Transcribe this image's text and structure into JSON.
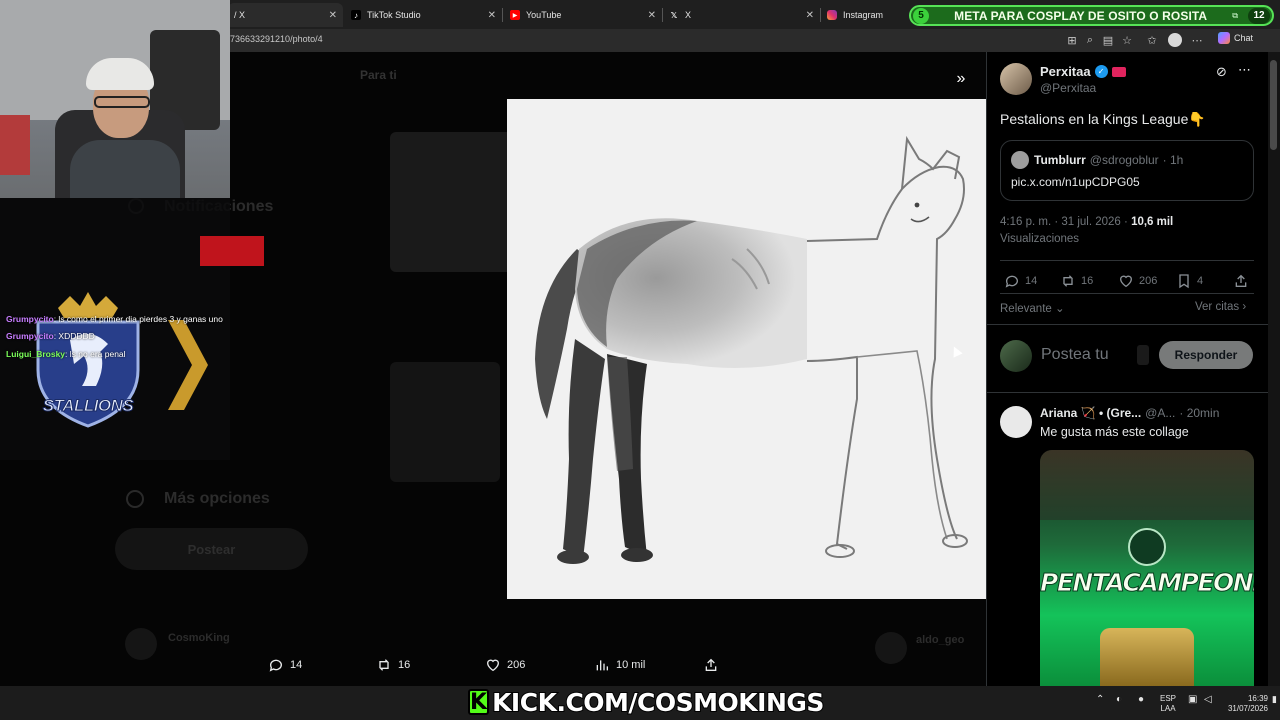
{
  "browser": {
    "tabs": [
      {
        "label": "/ X",
        "icon": "x-icon"
      },
      {
        "label": "TikTok Studio",
        "icon": "tiktok-icon"
      },
      {
        "label": "YouTube",
        "icon": "youtube-icon"
      },
      {
        "label": "X",
        "icon": "x-icon"
      },
      {
        "label": "Instagram",
        "icon": "instagram-icon"
      }
    ],
    "url": "736633291210/photo/4",
    "chat_label": "Chat"
  },
  "meta_goal": {
    "left_number": "5",
    "text": "META PARA COSPLAY DE OSITO O ROSITA",
    "count": "12"
  },
  "stream_chat": {
    "messages": [
      {
        "user": "Grumpycito",
        "text": ": ls como el primer dia pierdes 3 y ganas uno",
        "color": "#c77dff"
      },
      {
        "user": "Grumpycito",
        "text": ": XDDDDD",
        "color": "#c77dff"
      },
      {
        "user": "Luigui_Brosky",
        "text": ": ls no era penal",
        "color": "#7cff5a"
      }
    ],
    "team_logo_text": "STALLIONS"
  },
  "background_page": {
    "nav_notifications": "Notificaciones",
    "nav_more": "Más opciones",
    "post_button": "Postear",
    "for_you_tab": "Para ti",
    "side_user_1": "CosmoKing",
    "side_user_2": "aldo_geo"
  },
  "media_bar": {
    "replies": "14",
    "reposts": "16",
    "likes": "206",
    "views": "10 mil"
  },
  "tweet": {
    "author_name": "Perxitaa",
    "author_handle": "@Perxitaa",
    "text": "Pestalions en la Kings League👇",
    "quote": {
      "author_name": "Tumblurr",
      "author_handle": "@sdrogoblur",
      "time": "· 1h",
      "link": "pic.x.com/n1upCDPG05"
    },
    "timestamp": "4:16 p. m. · 31 jul. 2026 ·",
    "views_count": "10,6 mil",
    "views_label": "Visualizaciones",
    "stats": {
      "replies": "14",
      "reposts": "16",
      "likes": "206",
      "bookmarks": "4"
    },
    "relevance_label": "Relevante",
    "quotes_label": "Ver citas",
    "reply_placeholder": "Postea tu",
    "reply_button": "Responder"
  },
  "reply_tweet": {
    "author_name": "Ariana 🏹 • (Gre...",
    "author_handle": "@A...",
    "time": "· 20min",
    "text": "Me gusta más este collage",
    "image_text": "PENTACAMPEONES"
  },
  "taskbar": {
    "banner": "KICK.COM/COSMOKINGS",
    "language": "ESP",
    "layout": "LAA",
    "time": "16:39",
    "date": "31/07/2026"
  },
  "colors": {
    "x_blue": "#1d9bf0",
    "kick_green": "#53fc18",
    "meta_green": "#1c6b1c"
  }
}
